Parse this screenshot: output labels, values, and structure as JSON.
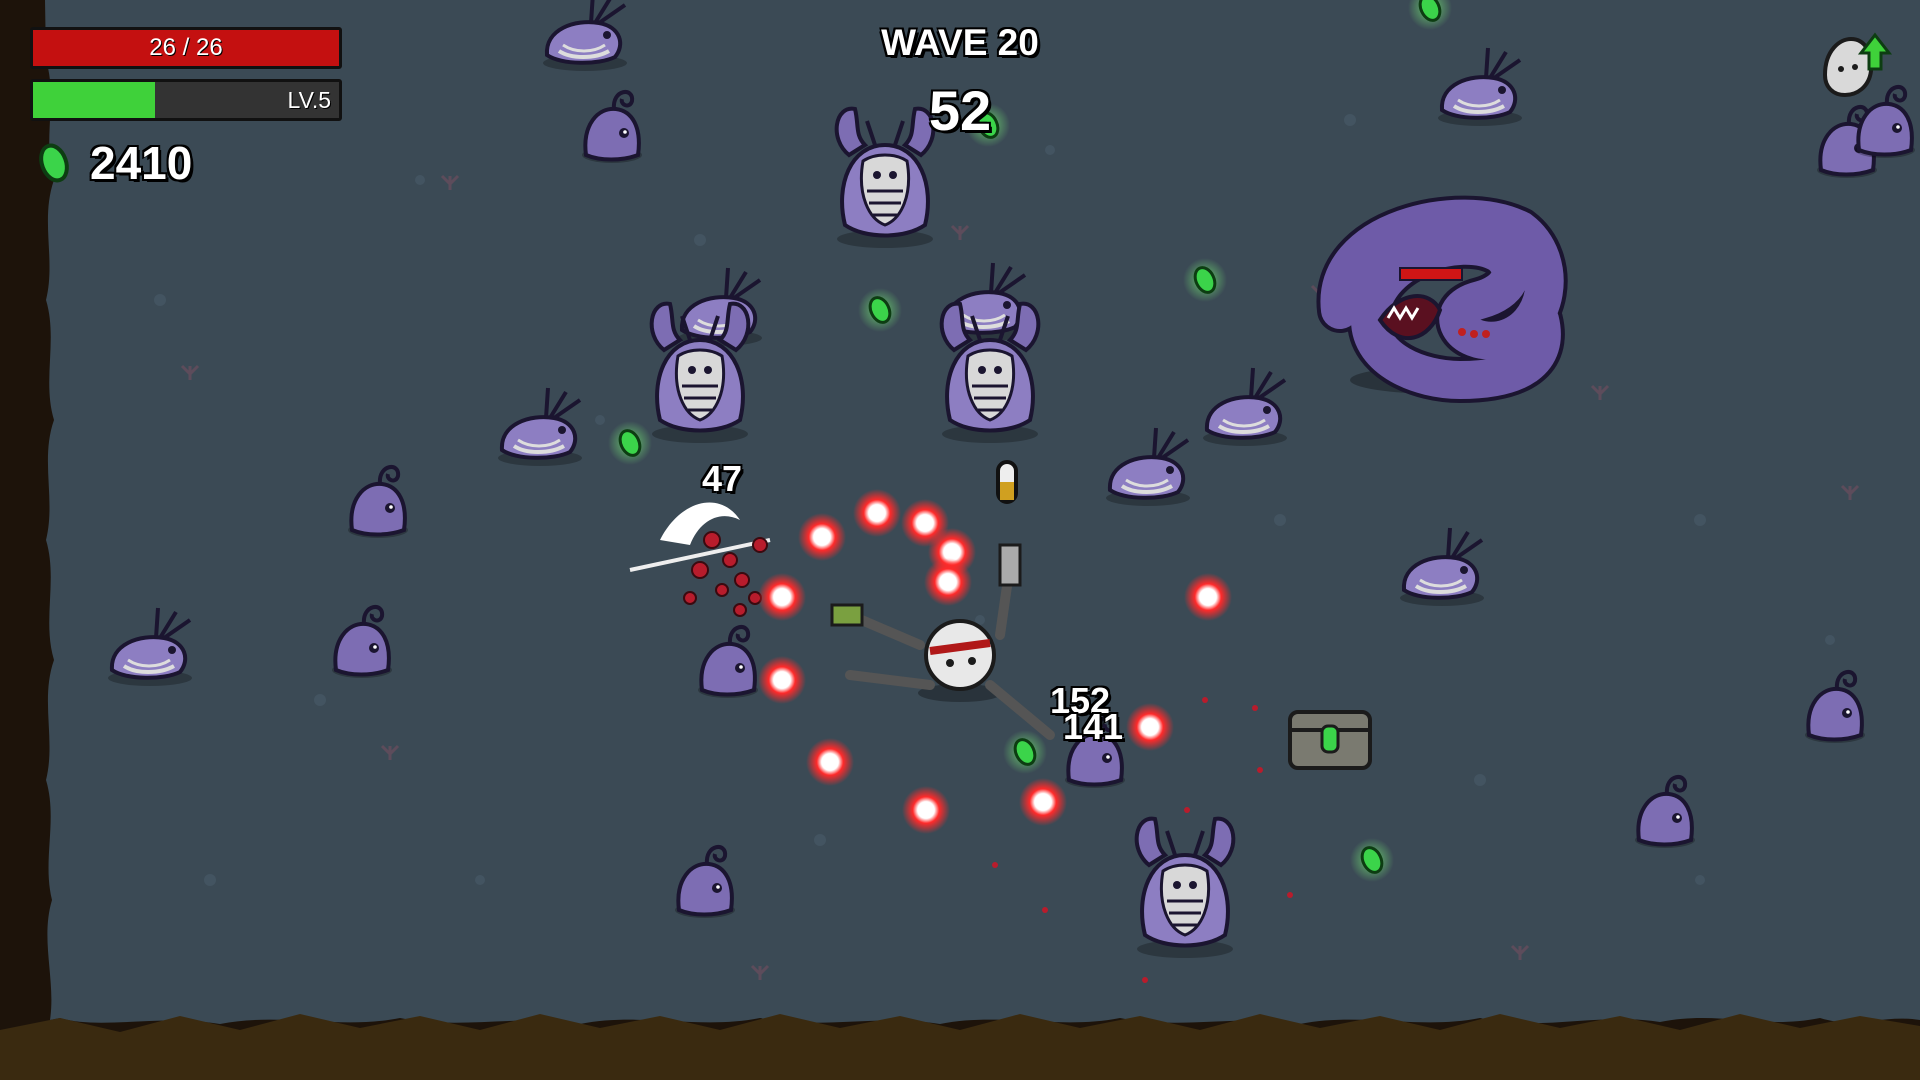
{
  "hud": {
    "hp_text": "26 / 26",
    "hp_fraction": 1.0,
    "xp_level_text": "LV.5",
    "xp_fraction": 0.4,
    "materials_count": "2410",
    "wave_label": "WAVE 20",
    "wave_timer": "52"
  },
  "damage_numbers": {
    "hit_1": "47",
    "hit_2": "152",
    "hit_3": "141"
  },
  "colors": {
    "ground": "#3b4a55",
    "hp": "#c41010",
    "xp": "#3fd13a",
    "material": "#3bd44a",
    "enemy_purple": "#7a6bb0",
    "projectile": "#ff2a2a"
  }
}
